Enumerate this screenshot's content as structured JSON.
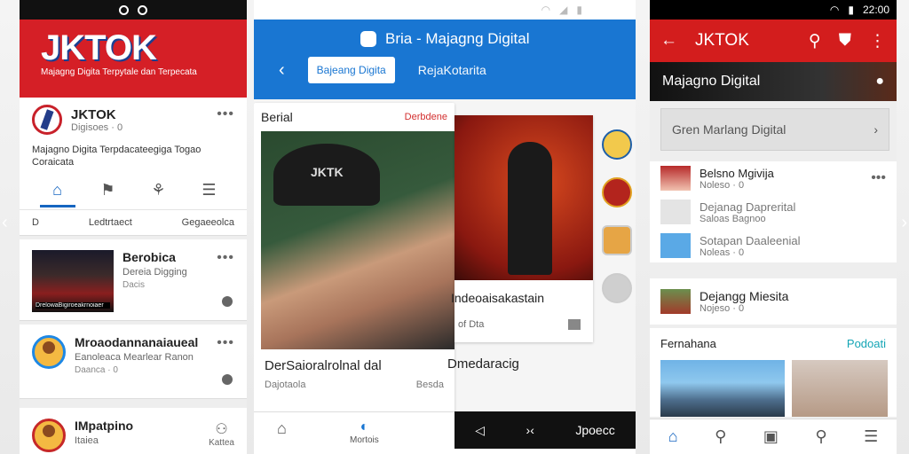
{
  "left": {
    "status_time": "",
    "brand": "JKTOK",
    "tagline": "Majagng Digita Terpytale dan Terpecata",
    "profile": {
      "name": "JKTOK",
      "sub": "Digisoes · 0",
      "desc": "Majagno Digita Terpdacateegiga Togao Coraicata"
    },
    "filter": {
      "left": "D",
      "mid": "Ledtrtaect",
      "right": "Gegaeeolca"
    },
    "posts": [
      {
        "title": "Berobica",
        "sub": "Dereia Digging",
        "meta": "Dacis",
        "caption": "DrelowaBigiroeakrnoiaer"
      },
      {
        "title": "Mroaodannanaiaueal",
        "sub": "Eanoleaca Mearlear Ranon",
        "meta": "Daanca · 0"
      },
      {
        "title": "IMpatpino",
        "sub": "Itaiea",
        "meta": "Kattea"
      }
    ]
  },
  "center": {
    "app_title": "Bria - Majagng Digital",
    "pill": "Bajeang Digita",
    "tab2": "RejaKotarita",
    "card": {
      "header": "Berial",
      "header_right": "Derbdene",
      "hat_text": "JKTK",
      "caption": "DerSaioralrolnal dal",
      "meta_left": "Dajotaola",
      "meta_right": "Besda"
    },
    "side": {
      "title": "Indeoaisakastain",
      "meta": "of Dta"
    },
    "below": "Dmedaracig",
    "nav": {
      "center_label": "Mortois"
    },
    "black_bar": {
      "mid": "›‹",
      "right": "Jpoecс"
    }
  },
  "right": {
    "status_time": "22:00",
    "title": "JKTOK",
    "strip": "Majagno Digital",
    "search": "Gren Marlang Digital",
    "list": [
      {
        "name": "Belsno Mgivija",
        "meta": "Noleso · 0"
      },
      {
        "name": "Dejanag Daprerital",
        "meta": "Saloas Bagnoo"
      },
      {
        "name": "Sotapan Daaleenial",
        "meta": "Noleas · 0"
      }
    ],
    "card": {
      "name": "Dejangg Miesita",
      "meta": "Nojeso · 0"
    },
    "featured": {
      "title": "Fernahana",
      "link": "Podoati"
    }
  }
}
